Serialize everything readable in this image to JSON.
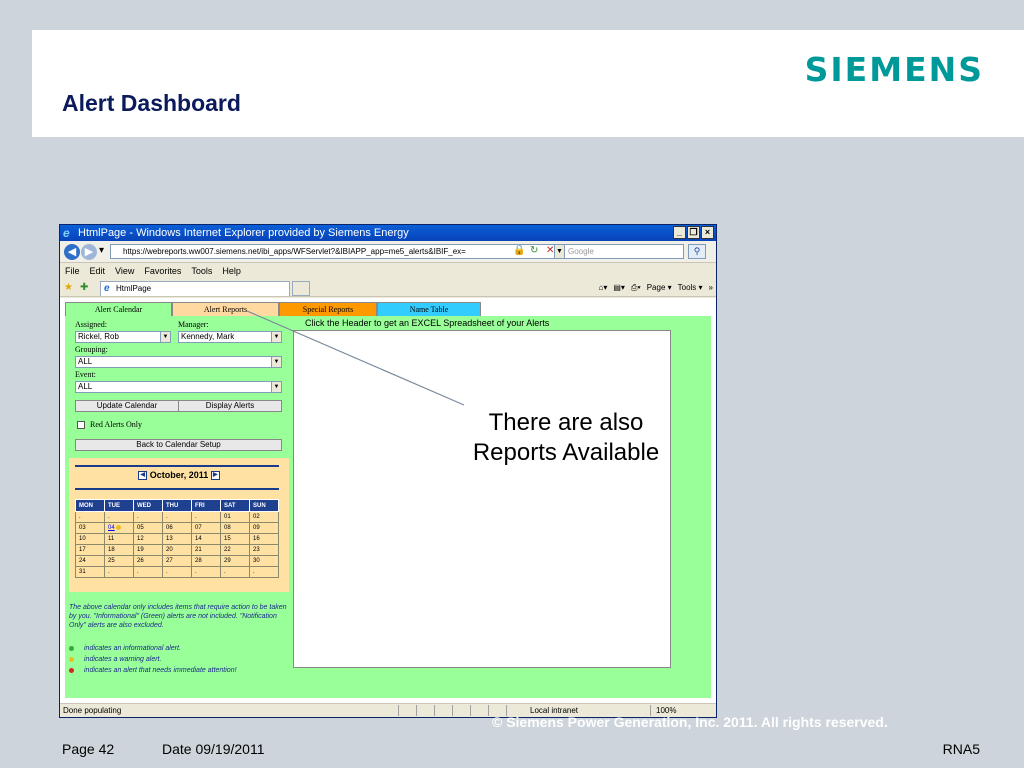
{
  "slide": {
    "title": "Alert Dashboard",
    "logo": "SIEMENS",
    "callout": "There are also Reports Available",
    "copyright": "©  Siemens Power Generation, Inc. 2011. All rights reserved.",
    "footer": {
      "page": "Page 42",
      "date": "Date 09/19/2011",
      "code": "RNA5"
    }
  },
  "browser": {
    "title": "HtmlPage - Windows Internet Explorer provided by Siemens Energy",
    "window_buttons": [
      "_",
      "❐",
      "×"
    ],
    "url": "https://webreports.ww007.siemens.net/ibi_apps/WFServlet?&IBIAPP_app=me5_alerts&IBIF_ex=",
    "search_placeholder": "Google",
    "menu": [
      "File",
      "Edit",
      "View",
      "Favorites",
      "Tools",
      "Help"
    ],
    "tab_title": "HtmlPage",
    "command_bar": {
      "page": "Page ▾",
      "tools": "Tools ▾"
    },
    "status": {
      "left": "Done populating",
      "zone": "Local intranet",
      "zoom": "100%"
    }
  },
  "app": {
    "tabs": [
      "Alert Calendar",
      "Alert Reports",
      "Special Reports",
      "Name Table"
    ],
    "results_header": "Click the Header to get an EXCEL Spreadsheet of your Alerts",
    "assigned_label": "Assigned:",
    "assigned_value": "Rickel, Rob",
    "manager_label": "Manager:",
    "manager_value": "Kennedy, Mark",
    "grouping_label": "Grouping:",
    "grouping_value": "ALL",
    "event_label": "Event:",
    "event_value": "ALL",
    "update_calendar": "Update Calendar",
    "display_alerts": "Display Alerts",
    "red_alerts_only": "Red Alerts Only",
    "back_to_setup": "Back to Calendar Setup",
    "calendar": {
      "month": "October, 2011",
      "days": [
        "MON",
        "TUE",
        "WED",
        "THU",
        "FRI",
        "SAT",
        "SUN"
      ],
      "weeks": [
        [
          ".",
          ".",
          ".",
          ".",
          ".",
          "01",
          "02"
        ],
        [
          "03",
          "04",
          "05",
          "06",
          "07",
          "08",
          "09"
        ],
        [
          "10",
          "11",
          "12",
          "13",
          "14",
          "15",
          "16"
        ],
        [
          "17",
          "18",
          "19",
          "20",
          "21",
          "22",
          "23"
        ],
        [
          "24",
          "25",
          "26",
          "27",
          "28",
          "29",
          "30"
        ],
        [
          "31",
          ".",
          ".",
          ".",
          ".",
          ".",
          "."
        ]
      ]
    },
    "note": "The above calendar only includes items that require action to be taken by you.  \"Informational\" (Green) alerts are not included.  \"Notification Only\" alerts are also excluded.",
    "legend": [
      {
        "text": "indicates an informational alert.",
        "color": "#33aa33"
      },
      {
        "text": "indicates a warning alert.",
        "color": "#e8c020"
      },
      {
        "text": "indicates an alert that needs immediate attention!",
        "color": "#dd2222"
      }
    ]
  }
}
